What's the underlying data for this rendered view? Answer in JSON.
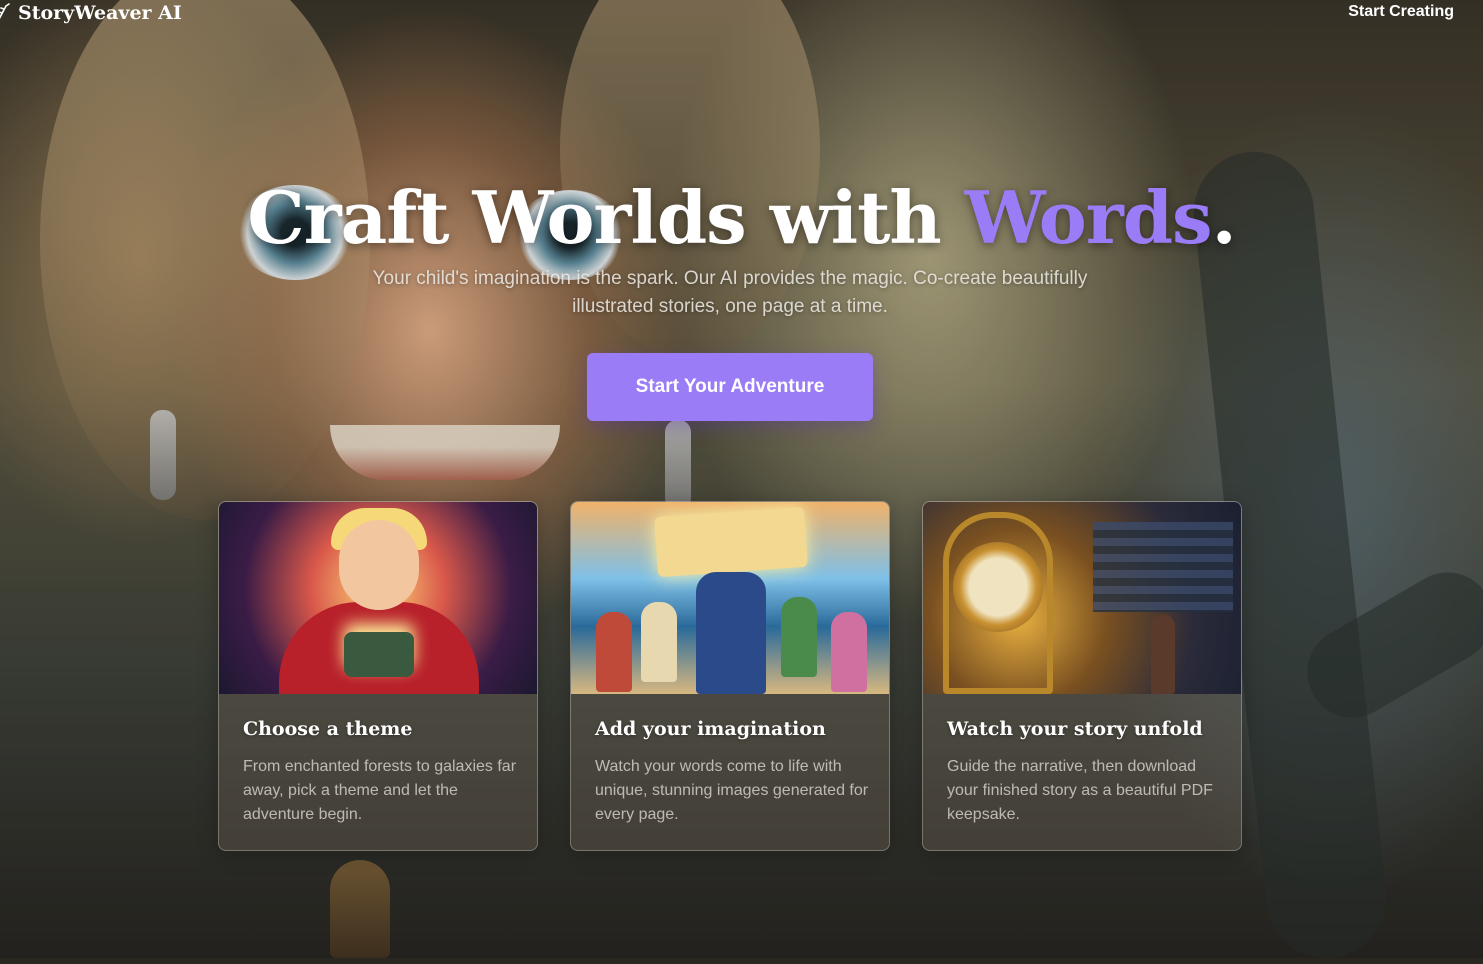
{
  "nav": {
    "brand": "StoryWeaver AI",
    "cta_label": "Start Creating"
  },
  "hero": {
    "title_main": "Craft Worlds with ",
    "title_accent": "Words",
    "title_end": ".",
    "subtitle": "Your child's imagination is the spark. Our AI provides the magic. Co-create beautifully illustrated stories, one page at a time.",
    "button_label": "Start Your Adventure"
  },
  "cards": [
    {
      "title": "Choose a theme",
      "description": "From enchanted forests to galaxies far away, pick a theme and let the adventure begin."
    },
    {
      "title": "Add your imagination",
      "description": "Watch your words come to life with unique, stunning images generated for every page."
    },
    {
      "title": "Watch your story unfold",
      "description": "Guide the narrative, then download your finished story as a beautiful PDF keepsake."
    }
  ],
  "colors": {
    "accent": "#9b7cf7",
    "text": "#ffffff"
  }
}
